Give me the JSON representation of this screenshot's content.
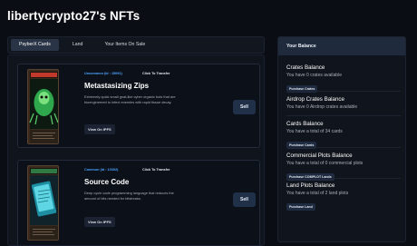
{
  "page": {
    "title": "libertycrypto27's NFTs"
  },
  "tabs": [
    {
      "label": "PsyberX Cards",
      "active": true
    },
    {
      "label": "Land",
      "active": false
    },
    {
      "label": "Your Items On Sale",
      "active": false
    }
  ],
  "cards": [
    {
      "rarity": "Uncommon (Id : 15091)",
      "transfer": "Click To Transfer",
      "title": "Metastasizing Zips",
      "description": "Extremely quick small gnat-like cyber organic bots that are bioengineered to infect enemies with rapid tissue decay.",
      "ipfs_label": "View On IPFS",
      "sell_label": "Sell",
      "image": {
        "banner": "METASTASIZING ZIPS",
        "icon": "green-creature-icon",
        "accent": "#3fbf5a"
      }
    },
    {
      "rarity": "Common (Id : 10302)",
      "transfer": "Click To Transfer",
      "title": "Source Code",
      "description": "Deep cycle code programming language that reduces the amount of bits needed for bitstreaks.",
      "ipfs_label": "View On IPFS",
      "sell_label": "Sell",
      "image": {
        "banner": "SOURCE CODE",
        "icon": "tablet-icon",
        "accent": "#3fb8c9"
      }
    }
  ],
  "balance": {
    "header": "Your Balance",
    "sections": [
      {
        "title": "Crates Balance",
        "text": "You have 0 crates available",
        "button": "Purchase Crates"
      },
      {
        "title": "Airdrop Crates Balance",
        "text": "You have 0 Airdrop crates available",
        "button": ""
      },
      {
        "title": "Cards Balance",
        "text": "You have a total of 34 cards",
        "button": "Purchase Cards"
      },
      {
        "title": "Commercial Plots Balance",
        "text": "You have a total of 0 commercial plots",
        "button": "Purchase COMPLOT Lands"
      },
      {
        "title": "Land Plots Balance",
        "text": "You have a total of 2 land plots",
        "button": "Purchase Land"
      }
    ]
  },
  "colors": {
    "background": "#0a0d14",
    "accent_blue": "#4aa3ff",
    "button": "#213049"
  }
}
